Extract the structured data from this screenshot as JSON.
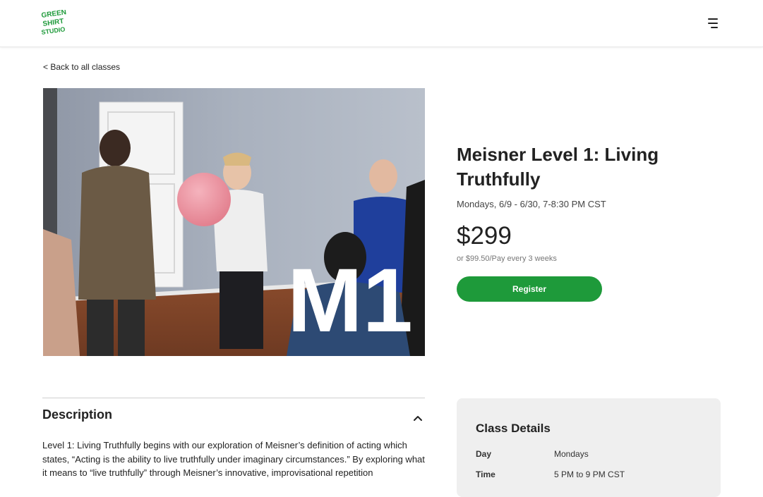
{
  "header": {
    "logo_text_lines": [
      "GREEN",
      "SHIRT",
      "STUDIO"
    ],
    "logo_color": "#1e9a3a"
  },
  "nav": {
    "back_label": "< Back to all classes"
  },
  "hero": {
    "overlay_text": "M1"
  },
  "class": {
    "title": "Meisner Level 1: Living Truthfully",
    "schedule": "Mondays, 6/9 - 6/30, 7-8:30 PM CST",
    "price": "$299",
    "payment_plan": "or $99.50/Pay every 3 weeks",
    "register_label": "Register",
    "accent_color": "#1e9a3a"
  },
  "description": {
    "heading": "Description",
    "body": "Level 1: Living Truthfully begins with our exploration of Meisner’s definition of acting which states, “Acting is the ability to live truthfully under imaginary circumstances.” By exploring what it means to “live truthfully” through Meisner’s innovative, improvisational repetition"
  },
  "details": {
    "title": "Class Details",
    "rows": [
      {
        "label": "Day",
        "value": "Mondays"
      },
      {
        "label": "Time",
        "value": "5 PM to 9 PM CST"
      }
    ]
  }
}
